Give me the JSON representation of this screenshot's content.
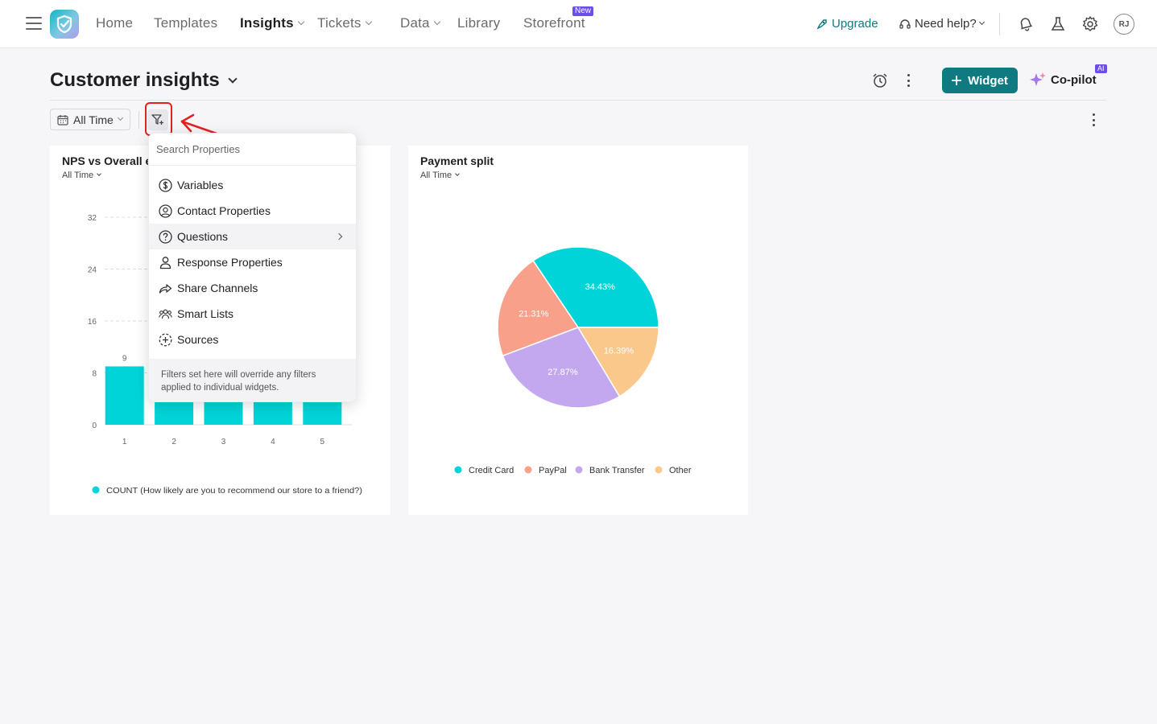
{
  "nav": {
    "items": [
      {
        "label": "Home",
        "left": 119
      },
      {
        "label": "Templates",
        "left": 191
      },
      {
        "label": "Insights"
      },
      {
        "label": "Tickets"
      },
      {
        "label": "Data"
      },
      {
        "label": "Library"
      },
      {
        "label": "Storefront"
      }
    ],
    "new_badge": "New",
    "upgrade": "Upgrade",
    "need_help": "Need help?",
    "avatar_initials": "RJ"
  },
  "header": {
    "title": "Customer insights",
    "widget_button": "Widget",
    "copilot": "Co-pilot",
    "ai_badge": "AI"
  },
  "toolbar": {
    "time_filter": "All Time"
  },
  "filter_menu": {
    "search_placeholder": "Search Properties",
    "items": [
      "Variables",
      "Contact Properties",
      "Questions",
      "Response Properties",
      "Share Channels",
      "Smart Lists",
      "Sources"
    ],
    "footer_note": "Filters set here will override any filters applied to individual widgets."
  },
  "widgets": [
    {
      "title": "NPS vs Overall e",
      "subtitle": "All Time"
    },
    {
      "title": "Payment split",
      "subtitle": "All Time"
    }
  ],
  "chart_data": [
    {
      "type": "bar",
      "title": "NPS vs Overall e",
      "categories": [
        "1",
        "2",
        "3",
        "4",
        "5"
      ],
      "series": [
        {
          "name": "COUNT (How likely are you to recommend our store to a friend?)",
          "values": [
            9,
            null,
            null,
            null,
            null
          ]
        }
      ],
      "data_labels": [
        "9"
      ],
      "yticks": [
        0,
        8,
        16,
        24,
        32
      ],
      "ylim": [
        0,
        32
      ],
      "grid": "dashed horizontal",
      "legend": "bottom",
      "color": "#00d4d8"
    },
    {
      "type": "pie",
      "title": "Payment split",
      "categories": [
        "Credit Card",
        "PayPal",
        "Bank Transfer",
        "Other"
      ],
      "values": [
        34.43,
        21.31,
        27.87,
        16.39
      ],
      "value_labels": [
        "34.43%",
        "21.31%",
        "27.87%",
        "16.39%"
      ],
      "colors": [
        "#00d4d8",
        "#f9a08a",
        "#c4a8ef",
        "#fbc88c"
      ],
      "legend": "bottom"
    }
  ]
}
